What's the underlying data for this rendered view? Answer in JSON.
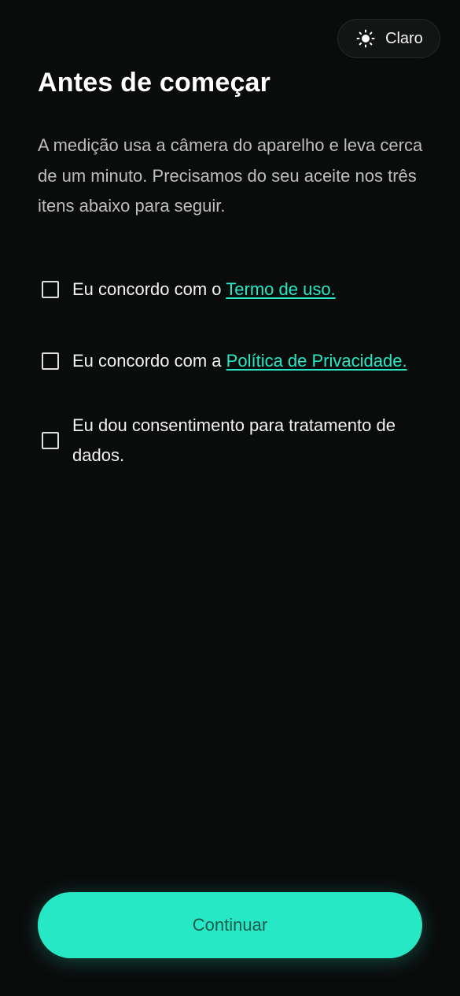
{
  "theme_toggle": {
    "icon": "sun-icon",
    "label": "Claro"
  },
  "title": "Antes de começar",
  "intro": "A medição usa a câmera do aparelho e leva cerca de um minuto. Precisamos do seu aceite nos três itens abaixo para seguir.",
  "consents": [
    {
      "text": "Eu concordo com o ",
      "link": "Termo de uso.",
      "checked": false
    },
    {
      "text": "Eu concordo com a ",
      "link": "Política de Privacidade.",
      "checked": false
    },
    {
      "text": "Eu dou consentimento para tratamento de dados.",
      "link": "",
      "checked": false
    }
  ],
  "continue_label": "Continuar",
  "colors": {
    "background": "#0a0b0b",
    "accent": "#27e8c5",
    "button_text": "#1f5c50"
  }
}
